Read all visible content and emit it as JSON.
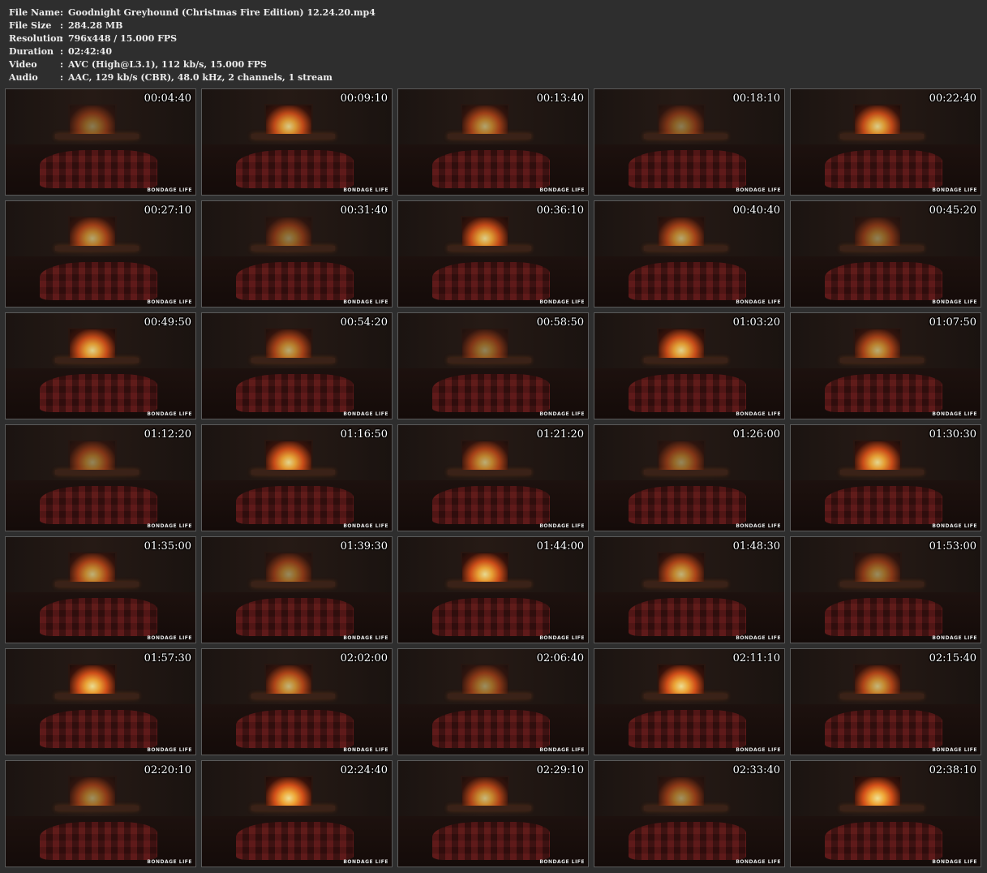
{
  "info": [
    {
      "label": "File Name",
      "sep": ":",
      "value": "Goodnight Greyhound (Christmas Fire Edition) 12.24.20.mp4"
    },
    {
      "label": "File Size",
      "sep": ":",
      "value": "284.28 MB"
    },
    {
      "label": "Resolution",
      "sep": ":",
      "value": "796x448 / 15.000 FPS"
    },
    {
      "label": "Duration",
      "sep": ":",
      "value": "02:42:40"
    },
    {
      "label": "Video",
      "sep": ":",
      "value": "AVC (High@L3.1), 112 kb/s, 15.000 FPS"
    },
    {
      "label": "Audio",
      "sep": ":",
      "value": "AAC, 129 kb/s (CBR), 48.0 kHz, 2 channels, 1 stream"
    }
  ],
  "watermark": "BONDAGE LIFE",
  "thumbnails": [
    {
      "time": "00:04:40"
    },
    {
      "time": "00:09:10"
    },
    {
      "time": "00:13:40"
    },
    {
      "time": "00:18:10"
    },
    {
      "time": "00:22:40"
    },
    {
      "time": "00:27:10"
    },
    {
      "time": "00:31:40"
    },
    {
      "time": "00:36:10"
    },
    {
      "time": "00:40:40"
    },
    {
      "time": "00:45:20"
    },
    {
      "time": "00:49:50"
    },
    {
      "time": "00:54:20"
    },
    {
      "time": "00:58:50"
    },
    {
      "time": "01:03:20"
    },
    {
      "time": "01:07:50"
    },
    {
      "time": "01:12:20"
    },
    {
      "time": "01:16:50"
    },
    {
      "time": "01:21:20"
    },
    {
      "time": "01:26:00"
    },
    {
      "time": "01:30:30"
    },
    {
      "time": "01:35:00"
    },
    {
      "time": "01:39:30"
    },
    {
      "time": "01:44:00"
    },
    {
      "time": "01:48:30"
    },
    {
      "time": "01:53:00"
    },
    {
      "time": "01:57:30"
    },
    {
      "time": "02:02:00"
    },
    {
      "time": "02:06:40"
    },
    {
      "time": "02:11:10"
    },
    {
      "time": "02:15:40"
    },
    {
      "time": "02:20:10"
    },
    {
      "time": "02:24:40"
    },
    {
      "time": "02:29:10"
    },
    {
      "time": "02:33:40"
    },
    {
      "time": "02:38:10"
    }
  ]
}
